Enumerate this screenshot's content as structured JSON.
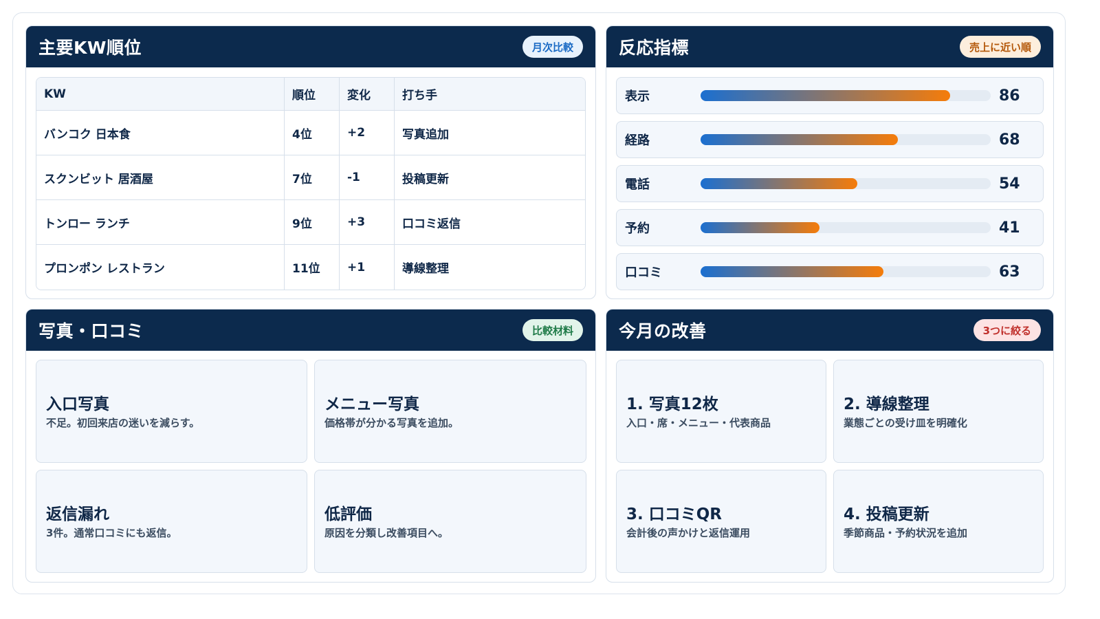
{
  "kw_panel": {
    "title": "主要KW順位",
    "badge": "月次比較",
    "badge_bg": "#e8f2fc",
    "badge_color": "#1a6ac4",
    "columns": [
      "KW",
      "順位",
      "変化",
      "打ち手"
    ],
    "rows": [
      [
        "バンコク 日本食",
        "4位",
        "+2",
        "写真追加"
      ],
      [
        "スクンビット 居酒屋",
        "7位",
        "-1",
        "投稿更新"
      ],
      [
        "トンロー ランチ",
        "9位",
        "+3",
        "口コミ返信"
      ],
      [
        "プロンポン レストラン",
        "11位",
        "+1",
        "導線整理"
      ]
    ]
  },
  "reaction_panel": {
    "title": "反応指標",
    "badge": "売上に近い順",
    "badge_bg": "#fdeedd",
    "badge_color": "#b4580a",
    "max": 100,
    "metrics": [
      {
        "label": "表示",
        "value": 86
      },
      {
        "label": "経路",
        "value": 68
      },
      {
        "label": "電話",
        "value": 54
      },
      {
        "label": "予約",
        "value": 41
      },
      {
        "label": "口コミ",
        "value": 63
      }
    ]
  },
  "photo_panel": {
    "title": "写真・口コミ",
    "badge": "比較材料",
    "badge_bg": "#e2f4ea",
    "badge_color": "#1e7a47",
    "cards": [
      {
        "title": "入口写真",
        "desc": "不足。初回来店の迷いを減らす。"
      },
      {
        "title": "メニュー写真",
        "desc": "価格帯が分かる写真を追加。"
      },
      {
        "title": "返信漏れ",
        "desc": "3件。通常口コミにも返信。"
      },
      {
        "title": "低評価",
        "desc": "原因を分類し改善項目へ。"
      }
    ]
  },
  "month_panel": {
    "title": "今月の改善",
    "badge": "3つに絞る",
    "badge_bg": "#fde3e3",
    "badge_color": "#c0302b",
    "cards": [
      {
        "title": "1. 写真12枚",
        "desc": "入口・席・メニュー・代表商品"
      },
      {
        "title": "2. 導線整理",
        "desc": "業態ごとの受け皿を明確化"
      },
      {
        "title": "3. 口コミQR",
        "desc": "会計後の声かけと返信運用"
      },
      {
        "title": "4. 投稿更新",
        "desc": "季節商品・予約状況を追加"
      }
    ]
  }
}
